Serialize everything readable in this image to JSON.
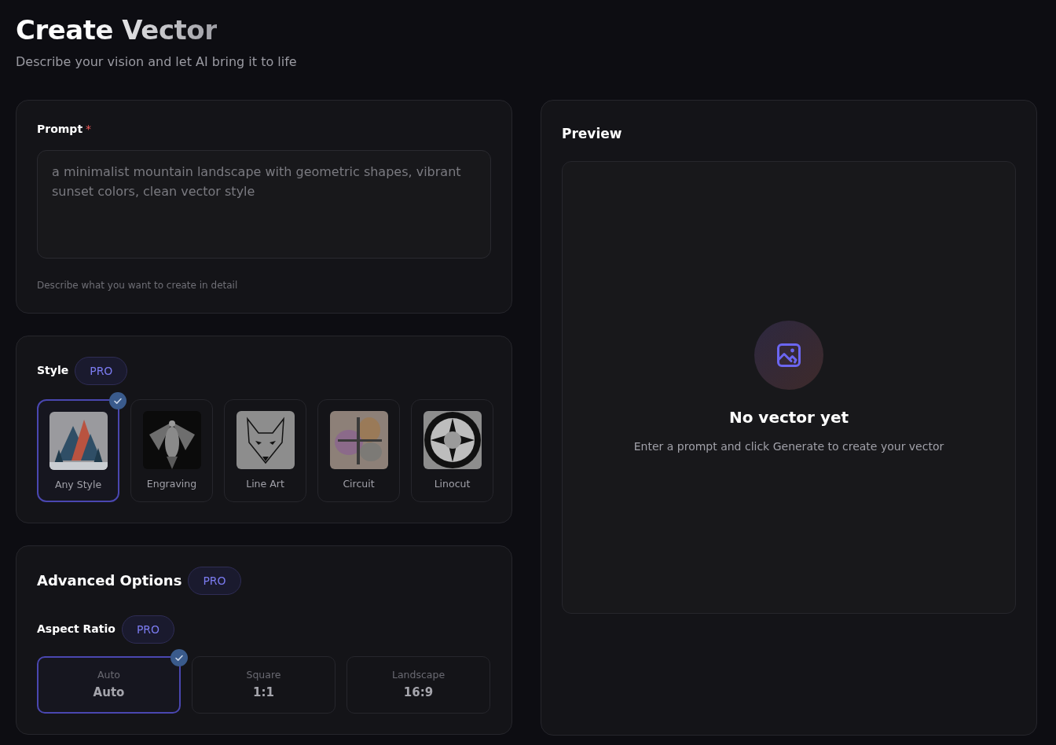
{
  "header": {
    "title": "Create Vector",
    "subtitle": "Describe your vision and let AI bring it to life"
  },
  "prompt": {
    "label": "Prompt",
    "required_mark": "*",
    "placeholder": "a minimalist mountain landscape with geometric shapes, vibrant sunset colors, clean vector style",
    "hint": "Describe what you want to create in detail"
  },
  "style": {
    "label": "Style",
    "badge": "PRO",
    "options": [
      {
        "label": "Any Style",
        "selected": true,
        "kind": "mountains"
      },
      {
        "label": "Engraving",
        "selected": false,
        "kind": "engraving"
      },
      {
        "label": "Line Art",
        "selected": false,
        "kind": "lineart"
      },
      {
        "label": "Circuit",
        "selected": false,
        "kind": "circuit"
      },
      {
        "label": "Linocut",
        "selected": false,
        "kind": "linocut"
      }
    ]
  },
  "advanced": {
    "title": "Advanced Options",
    "badge": "PRO",
    "aspect_ratio": {
      "label": "Aspect Ratio",
      "badge": "PRO",
      "options": [
        {
          "name": "Auto",
          "ratio": "Auto",
          "selected": true
        },
        {
          "name": "Square",
          "ratio": "1:1",
          "selected": false
        },
        {
          "name": "Landscape",
          "ratio": "16:9",
          "selected": false
        }
      ]
    }
  },
  "preview": {
    "title": "Preview",
    "empty_title": "No vector yet",
    "empty_text": "Enter a prompt and click Generate to create your vector"
  }
}
